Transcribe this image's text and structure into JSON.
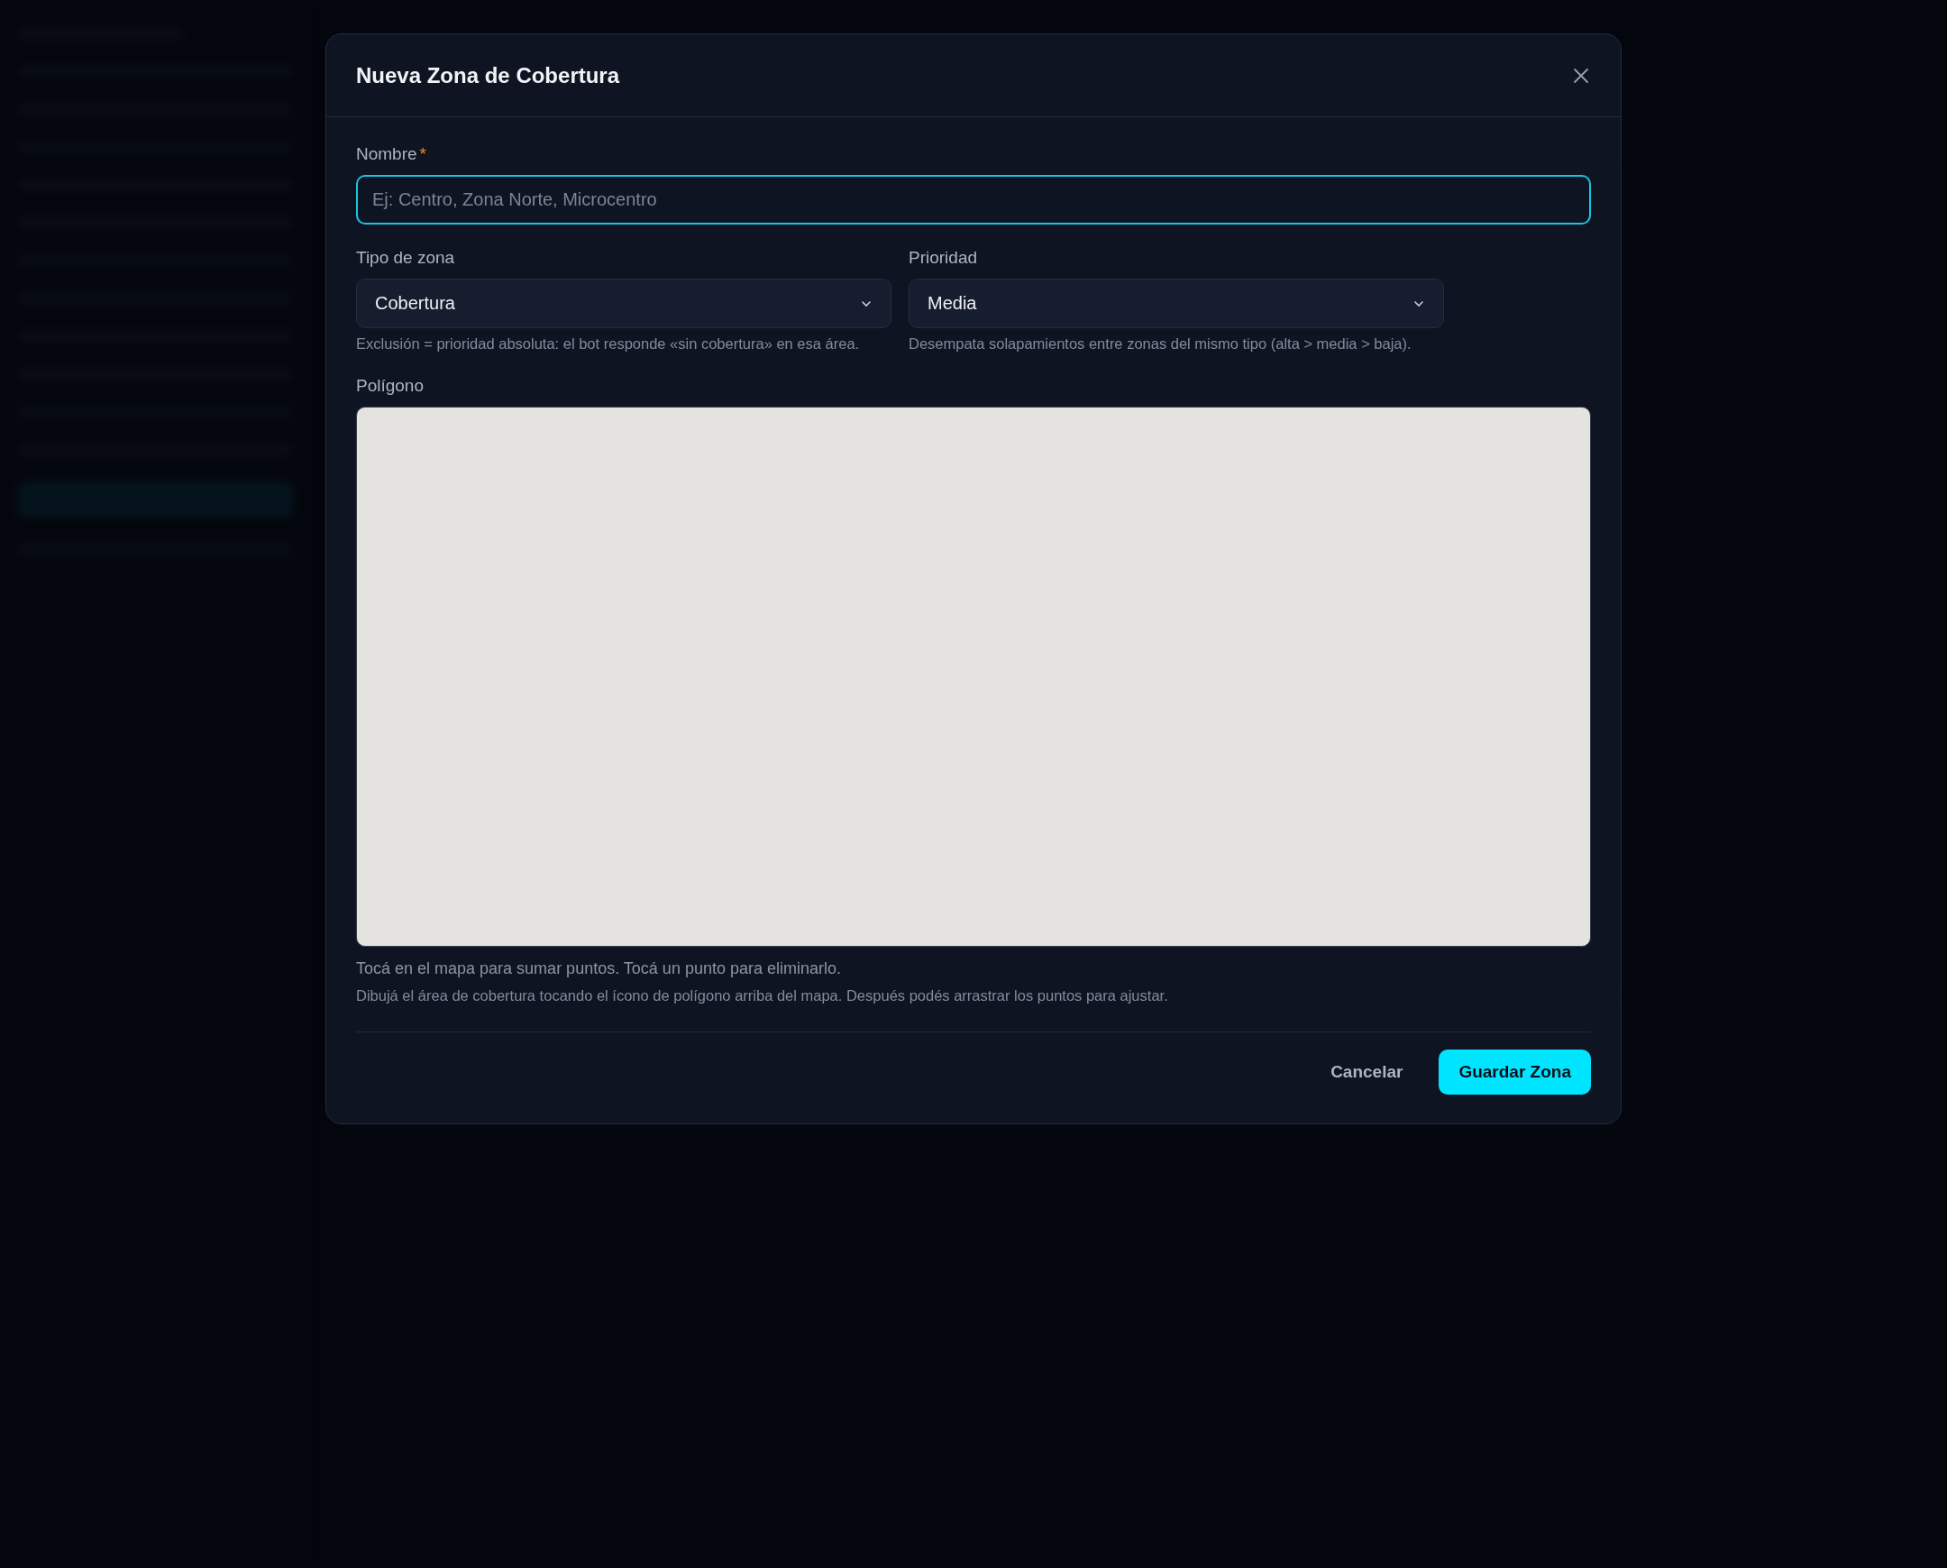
{
  "dialog": {
    "title": "Nueva Zona de Cobertura",
    "name_field": {
      "label": "Nombre",
      "required_mark": "*",
      "placeholder": "Ej: Centro, Zona Norte, Microcentro",
      "focused": true
    },
    "selects": [
      {
        "label": "Tipo de zona",
        "value": "Cobertura",
        "hint": "Exclusión = prioridad absoluta: el bot responde «sin cobertura» en esa área."
      },
      {
        "label": "Prioridad",
        "value": "Media",
        "hint": "Desempata solapamientos entre zonas del mismo tipo (alta > media > baja)."
      }
    ],
    "map": {
      "label": "Polígono",
      "hints": [
        "Tocá en el mapa para sumar puntos. Tocá un punto para eliminarlo.",
        "Dibujá el área de cobertura tocando el ícono de polígono arriba del mapa. Después podés arrastrar los puntos para ajustar."
      ]
    },
    "buttons": [
      {
        "kind": "secondary",
        "label": "Cancelar"
      },
      {
        "kind": "primary",
        "label": "Guardar Zona"
      }
    ]
  }
}
